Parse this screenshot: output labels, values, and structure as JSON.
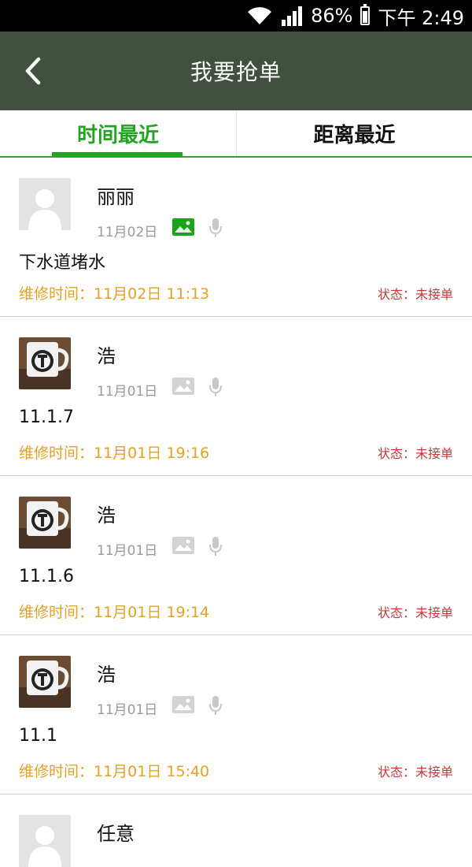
{
  "status_bar": {
    "battery_percent": "86%",
    "time": "下午 2:49",
    "battery_level": 0.86
  },
  "header": {
    "title": "我要抢单"
  },
  "tabs": [
    {
      "label": "时间最近",
      "active": true
    },
    {
      "label": "距离最近",
      "active": false
    }
  ],
  "orders": [
    {
      "name": "丽丽",
      "date": "11月02日",
      "has_image": true,
      "avatar": "default-avatar",
      "description": "下水道堵水",
      "repair_time": "维修时间：11月02日 11:13",
      "status": "状态：未接单"
    },
    {
      "name": "浩",
      "date": "11月01日",
      "has_image": false,
      "avatar": "mug-avatar",
      "description": "11.1.7",
      "repair_time": "维修时间：11月01日 19:16",
      "status": "状态：未接单"
    },
    {
      "name": "浩",
      "date": "11月01日",
      "has_image": false,
      "avatar": "mug-avatar",
      "description": "11.1.6",
      "repair_time": "维修时间：11月01日 19:14",
      "status": "状态：未接单"
    },
    {
      "name": "浩",
      "date": "11月01日",
      "has_image": false,
      "avatar": "mug-avatar",
      "description": "11.1",
      "repair_time": "维修时间：11月01日 15:40",
      "status": "状态：未接单"
    },
    {
      "name": "任意",
      "avatar": "default-avatar"
    }
  ],
  "colors": {
    "header_bg": "#41503f",
    "tab_active": "#22a322",
    "repair_time": "#e3a126",
    "status": "#c23b3b",
    "image_icon_active": "#1aa31a",
    "image_icon_inactive": "#d3d3d3"
  }
}
